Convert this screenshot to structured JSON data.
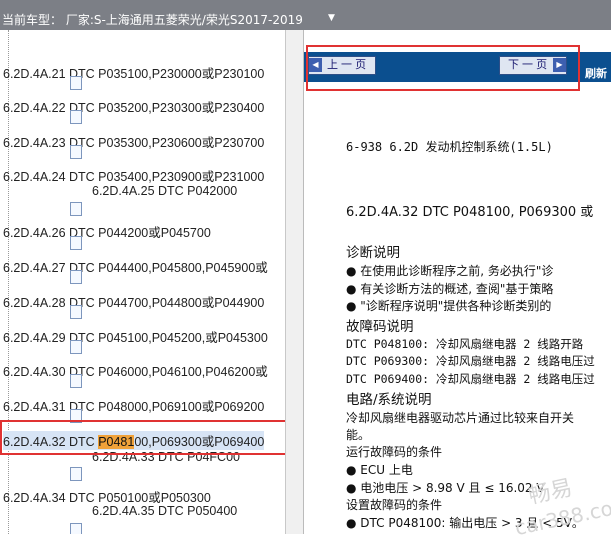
{
  "header": {
    "title": "当前车型： 厂家:S-上海通用五菱荣光/荣光S2017-2019",
    "arrow": "▼"
  },
  "tree": {
    "items": [
      {
        "label": "6.2D.4A.21 DTC P035100,P230000或P230100"
      },
      {
        "label": "6.2D.4A.22 DTC P035200,P230300或P230400"
      },
      {
        "label": "6.2D.4A.23 DTC P035300,P230600或P230700"
      },
      {
        "label": "6.2D.4A.24 DTC P035400,P230900或P231000"
      },
      {
        "label": "6.2D.4A.25 DTC P042000"
      },
      {
        "label": "6.2D.4A.26 DTC P044200或P045700"
      },
      {
        "label": "6.2D.4A.27 DTC P044400,P045800,P045900或"
      },
      {
        "label": "6.2D.4A.28 DTC P044700,P044800或P044900"
      },
      {
        "label": "6.2D.4A.29 DTC P045100,P045200,或P045300"
      },
      {
        "label": "6.2D.4A.30 DTC P046000,P046100,P046200或"
      },
      {
        "label": "6.2D.4A.31 DTC P048000,P069100或P069200"
      },
      {
        "label": "6.2D.4A.33 DTC P04FC00"
      },
      {
        "label": "6.2D.4A.34 DTC P050100或P050300"
      },
      {
        "label": "6.2D.4A.35 DTC P050400"
      }
    ],
    "selected": {
      "prefix": "6.2D.4A.32 DTC ",
      "highlight": "P0481",
      "suffix": "00,P069300或P069400"
    }
  },
  "nav": {
    "prev": "上 一 页",
    "next": "下 一 页",
    "refresh": "刷新"
  },
  "doc": {
    "header": "6-938  6.2D  发动机控制系统(1.5L)",
    "title": "6.2D.4A.32 DTC P048100, P069300 或",
    "s1": "诊断说明",
    "b1": "●   在使用此诊断程序之前, 务必执行\"诊",
    "b2": "●   有关诊断方法的概述, 查阅\"基于策略",
    "b3": "●   \"诊断程序说明\"提供各种诊断类别的",
    "s2": "故障码说明",
    "d1": "DTC P048100: 冷却风扇继电器 2 线路开路",
    "d2": "DTC P069300: 冷却风扇继电器 2 线路电压过",
    "d3": "DTC P069400: 冷却风扇继电器 2 线路电压过",
    "s3": "电路/系统说明",
    "p1": "冷却风扇继电器驱动芯片通过比较来自开关",
    "p2": "能。",
    "s4": "运行故障码的条件",
    "c1": "●   ECU 上电",
    "c2": "●   电池电压 > 8.98 V 且 ≤ 16.02 V",
    "s5": "设置故障码的条件",
    "c3": "●   DTC P048100: 输出电压 > 3 且 < 5V。"
  },
  "watermark": {
    "cn": "畅易",
    "url": "car388.com"
  },
  "colors": {
    "navbar": "#0b4f8f",
    "highlight": "#f0a23a",
    "redbox": "#e03232",
    "topbar": "#7c7f86"
  }
}
